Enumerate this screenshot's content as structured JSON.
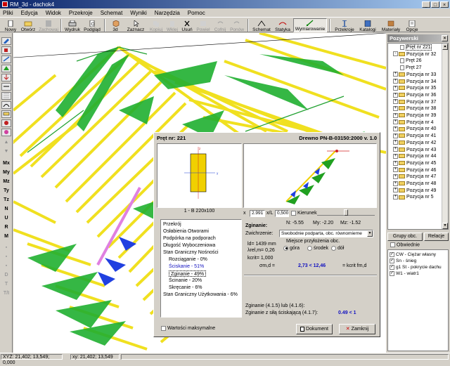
{
  "window": {
    "title": "RM_3d - dachok4"
  },
  "menu": [
    "Pliki",
    "Edycja",
    "Widok",
    "Przekroje",
    "Schemat",
    "Wyniki",
    "Narzędzia",
    "Pomoc"
  ],
  "toolbar": {
    "nowy": "Nowy",
    "otworz": "Otwórz",
    "zachowaj": "Zachowaj",
    "wydruk": "Wydruk",
    "podglad": "Podgląd",
    "view3d": "3d",
    "zaznacz": "Zaznacz",
    "kopiuj": "Kopiuj",
    "wklej": "Wklej",
    "usun": "Usuń",
    "powiel": "Powiel",
    "cofnij": "Cofnij",
    "ponow": "Ponów",
    "schemat": "Schemat",
    "statyka": "Statyka",
    "wymiarowanie": "Wymiarowanie",
    "przekroje": "Przekroje",
    "katalogi": "Katalogi",
    "materialy": "Materiały",
    "opcje": "Opcje"
  },
  "left_toolbar": [
    "Mx",
    "My",
    "Mz",
    "Ty",
    "Tz",
    "N",
    "U",
    "R",
    "M",
    "D",
    "T",
    "T/I"
  ],
  "right_panel": {
    "title": "Pozywerski",
    "tree": [
      {
        "label": "Pręt nr 221",
        "type": "doc",
        "indent": 3,
        "selected": true
      },
      {
        "label": "Pozycja nr 32",
        "type": "folder",
        "indent": 1,
        "expander": "-"
      },
      {
        "label": "Pręt 26",
        "type": "doc",
        "indent": 3
      },
      {
        "label": "Pręt 27",
        "type": "doc",
        "indent": 3
      },
      {
        "label": "Pozycja nr 33",
        "type": "folder",
        "indent": 1,
        "expander": "+"
      },
      {
        "label": "Pozycja nr 34",
        "type": "folder",
        "indent": 1,
        "expander": "+"
      },
      {
        "label": "Pozycja nr 35",
        "type": "folder",
        "indent": 1,
        "expander": "+"
      },
      {
        "label": "Pozycja nr 36",
        "type": "folder",
        "indent": 1,
        "expander": "+"
      },
      {
        "label": "Pozycja nr 37",
        "type": "folder",
        "indent": 1,
        "expander": "+"
      },
      {
        "label": "Pozycja nr 38",
        "type": "folder",
        "indent": 1,
        "expander": "+"
      },
      {
        "label": "Pozycja nr 39",
        "type": "folder",
        "indent": 1,
        "expander": "+"
      },
      {
        "label": "Pozycja nr 4",
        "type": "folder",
        "indent": 1,
        "expander": "+"
      },
      {
        "label": "Pozycja nr 40",
        "type": "folder",
        "indent": 1,
        "expander": "+"
      },
      {
        "label": "Pozycja nr 41",
        "type": "folder",
        "indent": 1,
        "expander": "+"
      },
      {
        "label": "Pozycja nr 42",
        "type": "folder",
        "indent": 1,
        "expander": "+"
      },
      {
        "label": "Pozycja nr 43",
        "type": "folder",
        "indent": 1,
        "expander": "+"
      },
      {
        "label": "Pozycja nr 44",
        "type": "folder",
        "indent": 1,
        "expander": "+"
      },
      {
        "label": "Pozycja nr 45",
        "type": "folder",
        "indent": 1,
        "expander": "+"
      },
      {
        "label": "Pozycja nr 46",
        "type": "folder",
        "indent": 1,
        "expander": "+"
      },
      {
        "label": "Pozycja nr 47",
        "type": "folder",
        "indent": 1,
        "expander": "+"
      },
      {
        "label": "Pozycja nr 48",
        "type": "folder",
        "indent": 1,
        "expander": "+"
      },
      {
        "label": "Pozycja nr 49",
        "type": "folder",
        "indent": 1,
        "expander": "+"
      },
      {
        "label": "Pozycja nr 5",
        "type": "folder",
        "indent": 1,
        "expander": "+"
      }
    ],
    "grupy_btn": "Grupy obc.",
    "relacje_btn": "Relacje",
    "obwiednie": "Obwiednie",
    "loads": [
      "CW - Ciężar własny",
      "Sn - śnieg",
      "g1 St - pokrycie dachu",
      "W1 - wiatr1"
    ]
  },
  "status": {
    "cell1": "XYZ: 21,402; 13,549; 0,000",
    "cell2": "xy: 21,402; 13,549"
  },
  "dialog": {
    "pret_label": "Pręt nr:",
    "pret_value": "221",
    "norm": "Drewno PN-B-03150:2000 v. 1.0",
    "section_name": "1 - B 220x100",
    "x_value": "2.991",
    "xl_label": "x/L",
    "xl_value": "0,500",
    "kierunek": "Kierunek",
    "menu_items": [
      {
        "label": "Przekrój",
        "indent": 0
      },
      {
        "label": "Osłabienia Otworami",
        "indent": 0
      },
      {
        "label": "Podpórka na podporach",
        "indent": 0
      },
      {
        "label": "Długość Wyboczeniowa",
        "indent": 0
      },
      {
        "label": "Stan Graniczny Nośności",
        "indent": 0
      },
      {
        "label": "Rozciąganie - 0%",
        "indent": 1
      },
      {
        "label": "Ściskanie - 51%",
        "indent": 1,
        "sel": true
      },
      {
        "label": "Zginanie - 49%",
        "indent": 1,
        "boxed": true
      },
      {
        "label": "Ścinanie - 20%",
        "indent": 1
      },
      {
        "label": "Skręcanie - 6%",
        "indent": 1
      },
      {
        "label": "Stan Graniczny Użytkowania - 6%",
        "indent": 0
      }
    ],
    "zginanie_title": "Zginanie:",
    "n_label": "N:",
    "n_value": "-5.55",
    "my_label": "My:",
    "my_value": "-2.20",
    "mz_label": "Mz:",
    "mz_value": "-1.52",
    "zwichrzenie_label": "Zwichrzenie:",
    "zwichrzenie_value": "Swobodnie podparta, obc. równomierne",
    "ld_label": "ld=",
    "ld_value": "1439 mm",
    "lambda_label": "λrel,m=",
    "lambda_value": "0,26",
    "kcrit_label": "kcrit=",
    "kcrit_value": "1,000",
    "miejsce_label": "Miejsce przyłożenia obc.",
    "radio_gora": "góra",
    "radio_srodek": "środek",
    "radio_dol": "dół",
    "sigma_label": "σm,d =",
    "sigma_value": "2,73 < 12,46",
    "sigma_right": "= kcrit fm,d",
    "zg_line1": "Zginanie (4.1.5) lub (4.1.6):",
    "zg_line2": "Zginanie z siłą ściskającą (4.1.7):",
    "zg_value2": "0.49 < 1",
    "wartosci_max": "Wartości maksymalne",
    "dokument_btn": "Dokument",
    "zamknij_btn": "Zamknij"
  }
}
